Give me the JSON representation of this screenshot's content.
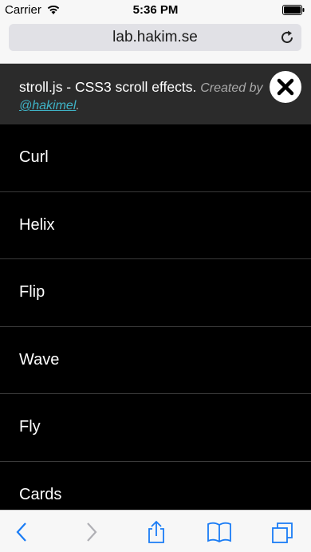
{
  "status_bar": {
    "carrier": "Carrier",
    "time": "5:36 PM"
  },
  "url_bar": {
    "url": "lab.hakim.se"
  },
  "banner": {
    "title": "stroll.js - CSS3 scroll effects.",
    "credit_prefix": "Created by",
    "author_link": "@hakimel",
    "credit_suffix": "."
  },
  "list": {
    "items": [
      {
        "label": "Curl"
      },
      {
        "label": "Helix"
      },
      {
        "label": "Flip"
      },
      {
        "label": "Wave"
      },
      {
        "label": "Fly"
      },
      {
        "label": "Cards"
      }
    ]
  },
  "toolbar": {
    "icons": [
      "back-icon",
      "forward-icon",
      "share-icon",
      "bookmarks-icon",
      "tabs-icon"
    ]
  },
  "colors": {
    "link": "#3fb3c6",
    "ios_blue": "#1a7cf5",
    "banner_bg": "#2b2b2b"
  }
}
